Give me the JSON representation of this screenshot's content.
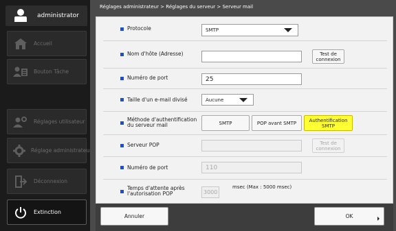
{
  "sidebar": {
    "user": "administrator",
    "items": [
      {
        "label": "Accueil",
        "icon": "home-icon"
      },
      {
        "label": "Bouton Tâche",
        "icon": "task-icon"
      },
      {
        "label": "Réglages utilisateur",
        "icon": "user-settings-icon"
      },
      {
        "label": "Réglage administrateur",
        "icon": "gear-icon"
      },
      {
        "label": "Déconnexion",
        "icon": "logout-icon"
      },
      {
        "label": "Extinction",
        "icon": "power-icon"
      }
    ]
  },
  "breadcrumb": "Réglages administrateur > Réglages du serveur > Serveur mail",
  "form": {
    "protocol_label": "Protocole",
    "protocol_value": "SMTP",
    "hostname_label": "Nom d'hôte (Adresse)",
    "hostname_value": "",
    "test_connection_label": "Test de connexion",
    "port_label": "Numéro de port",
    "port_value": "25",
    "split_label": "Taille d'un e-mail divisé",
    "split_value": "Aucune",
    "auth_label": "Méthode d'authentification du serveur mail",
    "auth_options": [
      "SMTP",
      "POP avant SMTP",
      "Authentification SMTP"
    ],
    "auth_selected": "Authentification SMTP",
    "pop_server_label": "Serveur POP",
    "pop_server_value": "",
    "pop_test_label": "Test de connexion",
    "pop_port_label": "Numéro de port",
    "pop_port_value": "110",
    "wait_label": "Temps d'attente après l'autorisation POP",
    "wait_value": "3000",
    "wait_note": "msec (Max : 5000 msec)"
  },
  "footer": {
    "cancel_label": "Annuler",
    "ok_label": "OK"
  },
  "colors": {
    "accent_bullet": "#1a4fd1",
    "selected_button": "#ffff33"
  }
}
